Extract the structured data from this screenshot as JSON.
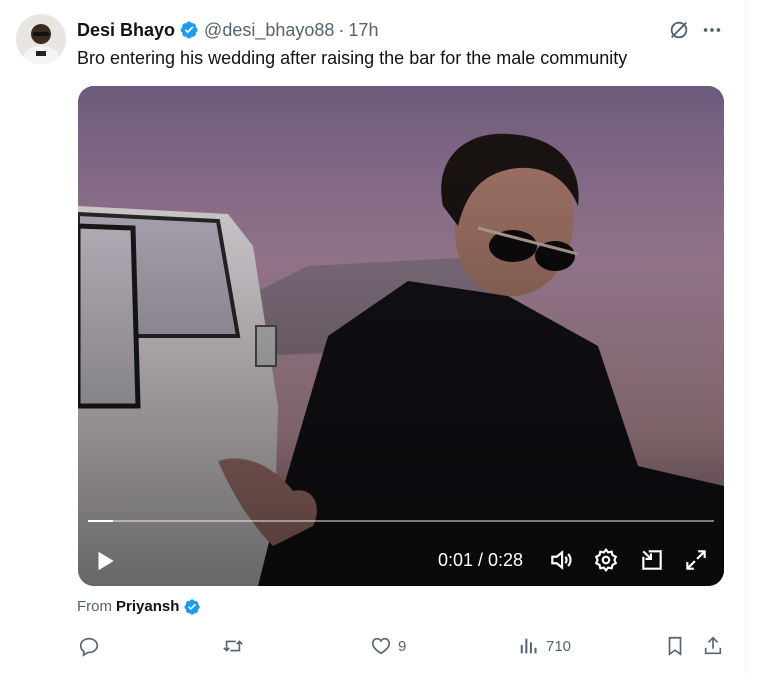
{
  "author": {
    "display_name": "Desi Bhayo",
    "handle": "@desi_bhayo88",
    "separator": "·",
    "time": "17h",
    "verified": true
  },
  "tweet": {
    "text": "Bro entering his wedding after raising the bar for the male community"
  },
  "video": {
    "time_readout": "0:01 / 0:28",
    "progress": 0.04
  },
  "attribution": {
    "from_label": "From",
    "name": "Priyansh",
    "verified": true
  },
  "actions": {
    "replies": "",
    "retweets": "",
    "likes": "9",
    "views": "710"
  },
  "colors": {
    "verified_blue": "#1d9bf0",
    "secondary_text": "#536471",
    "primary_text": "#0f1419"
  },
  "icons": {
    "grok": "grok-icon",
    "more": "more-icon",
    "play": "play-icon",
    "volume": "volume-icon",
    "settings": "settings-icon",
    "pip": "pip-icon",
    "fullscreen": "fullscreen-icon",
    "reply": "reply-icon",
    "retweet": "retweet-icon",
    "like": "heart-icon",
    "views": "views-icon",
    "bookmark": "bookmark-icon",
    "share": "share-icon"
  }
}
